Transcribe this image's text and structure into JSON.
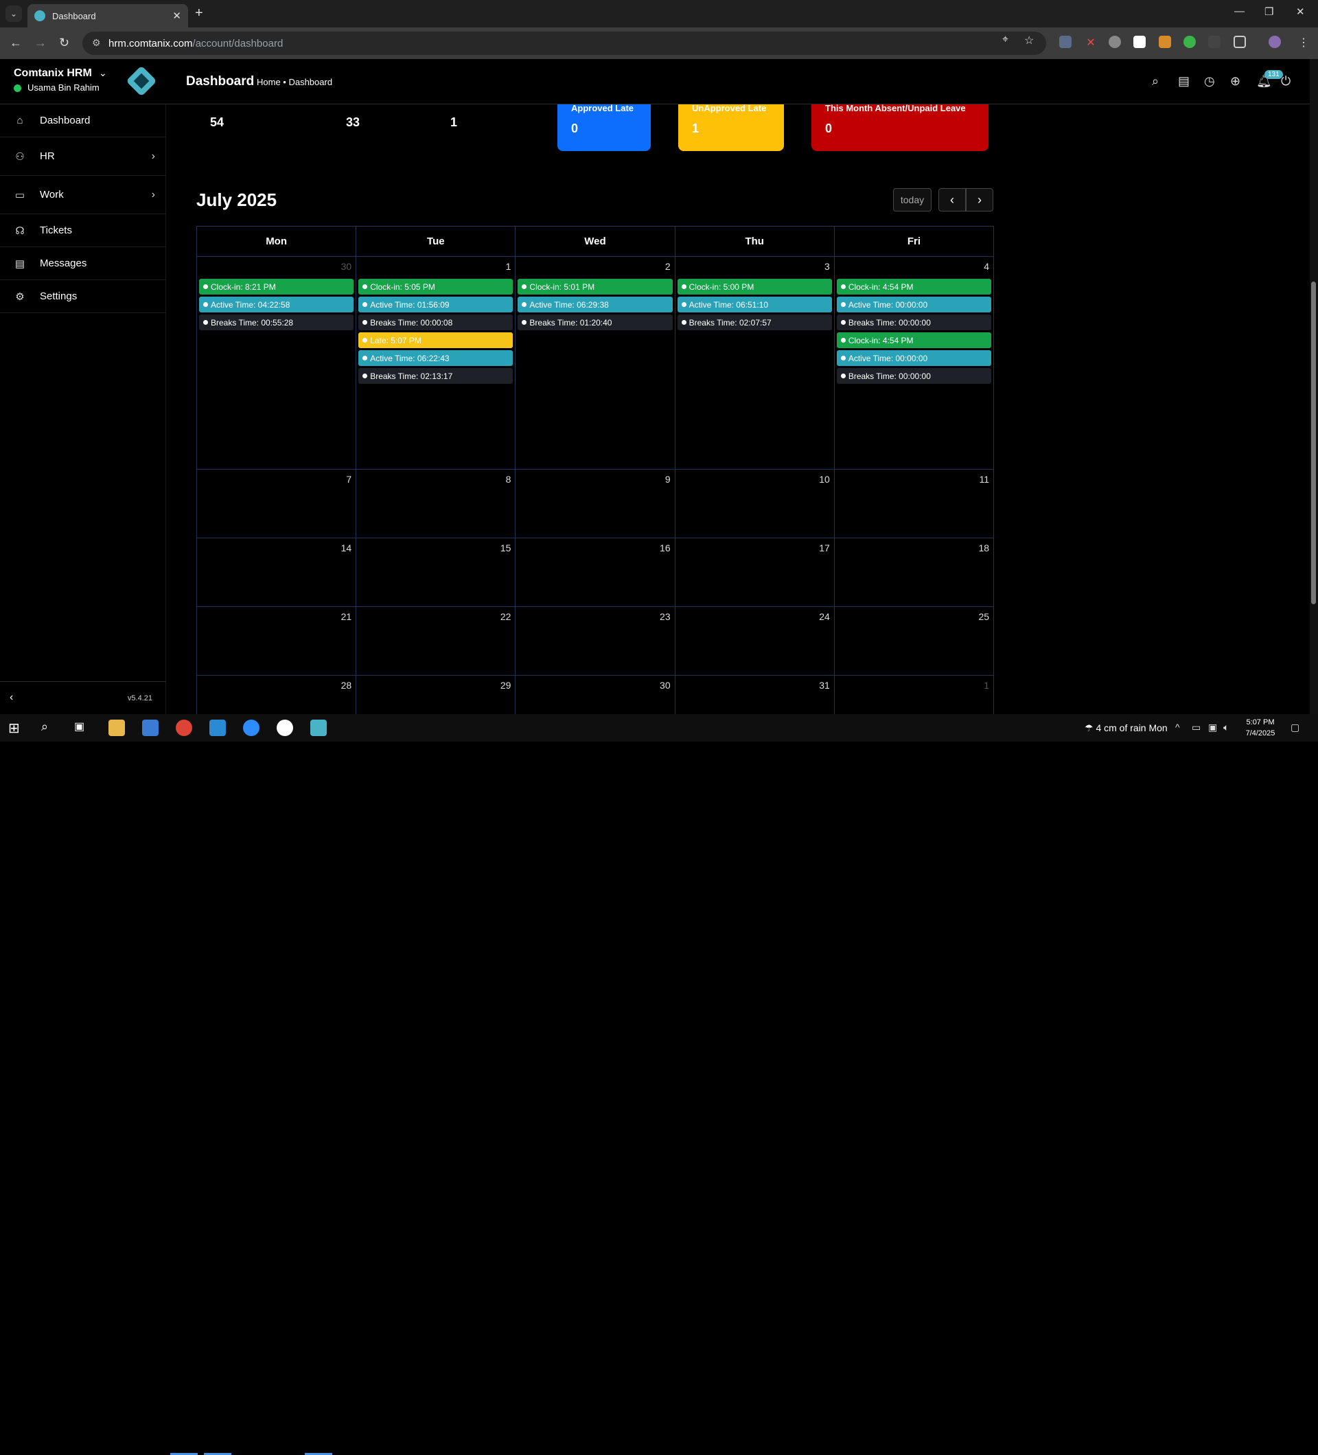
{
  "browser": {
    "tab_title": "Dashboard",
    "url_host": "hrm.comtanix.com",
    "url_path": "/account/dashboard"
  },
  "header": {
    "brand": "Comtanix HRM",
    "user": "Usama Bin Rahim",
    "page_title": "Dashboard",
    "breadcrumb": "Home • Dashboard",
    "notification_count": "131"
  },
  "sidebar": {
    "items": [
      {
        "label": "Dashboard",
        "icon": "home-icon"
      },
      {
        "label": "HR",
        "icon": "users-icon"
      },
      {
        "label": "Work",
        "icon": "briefcase-icon"
      },
      {
        "label": "Tickets",
        "icon": "headset-icon"
      },
      {
        "label": "Messages",
        "icon": "message-icon"
      },
      {
        "label": "Settings",
        "icon": "gear-icon"
      }
    ],
    "version": "v5.4.21"
  },
  "stats": {
    "values": [
      "54",
      "33",
      "1"
    ],
    "cards": [
      {
        "title": "Approved Late",
        "value": "0",
        "color": "#0d6efd"
      },
      {
        "title": "UnApproved Late",
        "value": "1",
        "color": "#ffc107"
      },
      {
        "title": "This Month Absent/Unpaid Leave",
        "value": "0",
        "color": "#c00000"
      }
    ]
  },
  "calendar": {
    "title": "July 2025",
    "today_label": "today",
    "weekdays": [
      "Mon",
      "Tue",
      "Wed",
      "Thu",
      "Fri"
    ],
    "weeks": [
      {
        "days": [
          {
            "num": "30",
            "muted": true,
            "events": [
              {
                "text": "Clock-in: 8:21 PM",
                "kind": "green"
              },
              {
                "text": "Active Time: 04:22:58",
                "kind": "teal"
              },
              {
                "text": "Breaks Time: 00:55:28",
                "kind": "dark"
              }
            ]
          },
          {
            "num": "1",
            "events": [
              {
                "text": "Clock-in: 5:05 PM",
                "kind": "green"
              },
              {
                "text": "Active Time: 01:56:09",
                "kind": "teal"
              },
              {
                "text": "Breaks Time: 00:00:08",
                "kind": "dark"
              },
              {
                "text": "Late: 5:07 PM",
                "kind": "yellow"
              },
              {
                "text": "Active Time: 06:22:43",
                "kind": "teal"
              },
              {
                "text": "Breaks Time: 02:13:17",
                "kind": "dark"
              }
            ]
          },
          {
            "num": "2",
            "events": [
              {
                "text": "Clock-in: 5:01 PM",
                "kind": "green"
              },
              {
                "text": "Active Time: 06:29:38",
                "kind": "teal"
              },
              {
                "text": "Breaks Time: 01:20:40",
                "kind": "dark"
              }
            ]
          },
          {
            "num": "3",
            "events": [
              {
                "text": "Clock-in: 5:00 PM",
                "kind": "green"
              },
              {
                "text": "Active Time: 06:51:10",
                "kind": "teal"
              },
              {
                "text": "Breaks Time: 02:07:57",
                "kind": "dark"
              }
            ]
          },
          {
            "num": "4",
            "events": [
              {
                "text": "Clock-in: 4:54 PM",
                "kind": "green"
              },
              {
                "text": "Active Time: 00:00:00",
                "kind": "teal"
              },
              {
                "text": "Breaks Time: 00:00:00",
                "kind": "dark"
              },
              {
                "text": "Clock-in: 4:54 PM",
                "kind": "green"
              },
              {
                "text": "Active Time: 00:00:00",
                "kind": "teal"
              },
              {
                "text": "Breaks Time: 00:00:00",
                "kind": "dark"
              }
            ]
          }
        ]
      },
      {
        "days": [
          {
            "num": "7"
          },
          {
            "num": "8"
          },
          {
            "num": "9"
          },
          {
            "num": "10"
          },
          {
            "num": "11"
          }
        ]
      },
      {
        "days": [
          {
            "num": "14"
          },
          {
            "num": "15"
          },
          {
            "num": "16"
          },
          {
            "num": "17"
          },
          {
            "num": "18"
          }
        ]
      },
      {
        "days": [
          {
            "num": "21"
          },
          {
            "num": "22"
          },
          {
            "num": "23"
          },
          {
            "num": "24"
          },
          {
            "num": "25"
          }
        ]
      },
      {
        "days": [
          {
            "num": "28"
          },
          {
            "num": "29"
          },
          {
            "num": "30"
          },
          {
            "num": "31"
          },
          {
            "num": "1",
            "muted": true
          }
        ]
      }
    ]
  },
  "taskbar": {
    "weather": "4 cm of rain Mon",
    "time": "5:07 PM",
    "date": "7/4/2025"
  }
}
